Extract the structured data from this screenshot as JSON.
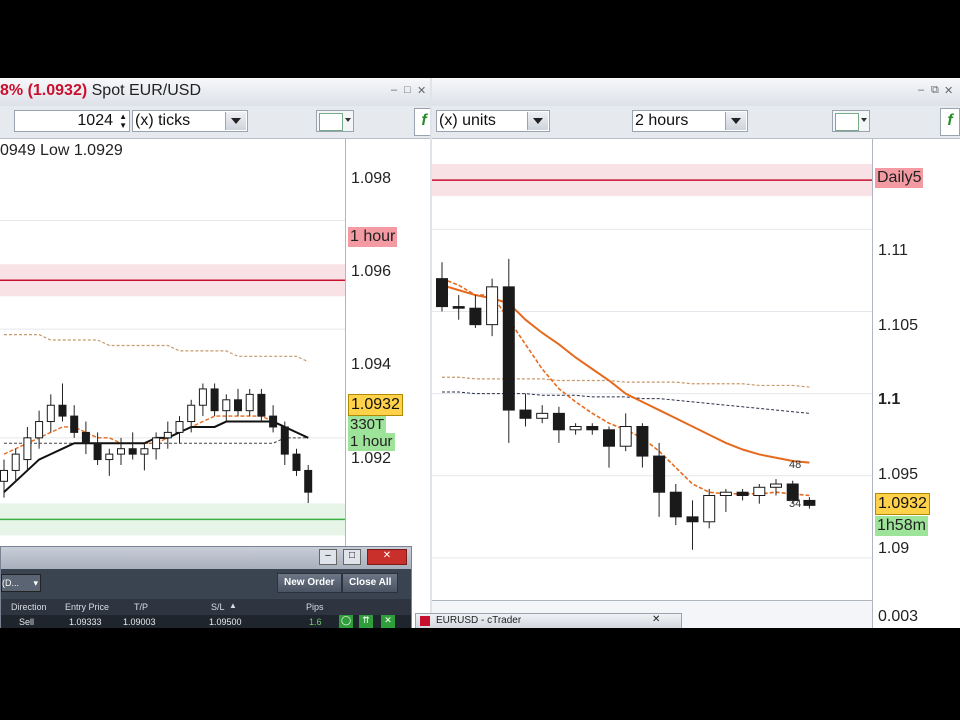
{
  "left": {
    "title_pct": "8% (1.0932)",
    "title_symbol": "Spot EUR/USD",
    "ticks_value": "1024",
    "ticks_unit": "(x) ticks",
    "hilo": "0949 Low 1.0929",
    "y_labels": [
      "1.098",
      "1.096",
      "1.094",
      "1.092"
    ],
    "tag_hour_red": "1 hour",
    "tag_price": "1.0932",
    "tag_ticks": "330T",
    "tag_hour_green": "1 hour"
  },
  "right": {
    "units_label": "(x) units",
    "timeframe": "2 hours",
    "y_labels": [
      "1.11",
      "1.105",
      "1.1",
      "1.095",
      "1.09"
    ],
    "tag_daily": "Daily5",
    "tag_price": "1.0932",
    "tag_time": "1h58m",
    "candle_label_top": "48",
    "candle_label_bot": "34",
    "sub_value": "0.003"
  },
  "panel": {
    "filter": "(D...",
    "new_order": "New Order",
    "close_all": "Close All",
    "columns": [
      "Direction",
      "Entry Price",
      "T/P",
      "S/L",
      "Pips"
    ],
    "row": [
      "Sell",
      "1.09333",
      "1.09003",
      "1.09500",
      "1.6"
    ]
  },
  "taskbar": {
    "label": "EURUSD - cTrader"
  },
  "colors": {
    "red_line": "#c8102e",
    "green_line": "#3cb043",
    "price_tag": "#ffd24a",
    "ma_orange": "#e56a1e"
  },
  "chart_data": [
    {
      "type": "candlestick",
      "title": "Spot EUR/USD",
      "ylim": [
        1.0905,
        1.0995
      ],
      "y_ticks": [
        1.098,
        1.096,
        1.094,
        1.092
      ],
      "levels": [
        1.0969,
        1.0925
      ],
      "candles": [
        [
          1.0932,
          1.0936,
          1.0929,
          1.0934
        ],
        [
          1.0934,
          1.0938,
          1.0932,
          1.0937
        ],
        [
          1.0936,
          1.0942,
          1.0934,
          1.094
        ],
        [
          1.094,
          1.0945,
          1.0938,
          1.0943
        ],
        [
          1.0943,
          1.0948,
          1.0941,
          1.0946
        ],
        [
          1.0946,
          1.095,
          1.0943,
          1.0944
        ],
        [
          1.0944,
          1.0946,
          1.094,
          1.0941
        ],
        [
          1.0941,
          1.0943,
          1.0937,
          1.0939
        ],
        [
          1.0939,
          1.0941,
          1.0935,
          1.0936
        ],
        [
          1.0936,
          1.0938,
          1.0933,
          1.0937
        ],
        [
          1.0937,
          1.094,
          1.0935,
          1.0938
        ],
        [
          1.0938,
          1.0941,
          1.0936,
          1.0937
        ],
        [
          1.0937,
          1.0939,
          1.0934,
          1.0938
        ],
        [
          1.0938,
          1.0941,
          1.0936,
          1.094
        ],
        [
          1.094,
          1.0943,
          1.0938,
          1.0941
        ],
        [
          1.0941,
          1.0944,
          1.0939,
          1.0943
        ],
        [
          1.0943,
          1.0947,
          1.0941,
          1.0946
        ],
        [
          1.0946,
          1.095,
          1.0944,
          1.0949
        ],
        [
          1.0949,
          1.095,
          1.0944,
          1.0945
        ],
        [
          1.0945,
          1.0948,
          1.0943,
          1.0947
        ],
        [
          1.0947,
          1.0949,
          1.0944,
          1.0945
        ],
        [
          1.0945,
          1.0949,
          1.0944,
          1.0948
        ],
        [
          1.0948,
          1.0949,
          1.0943,
          1.0944
        ],
        [
          1.0944,
          1.0946,
          1.0941,
          1.0942
        ],
        [
          1.0942,
          1.0943,
          1.0935,
          1.0937
        ],
        [
          1.0937,
          1.0938,
          1.0933,
          1.0934
        ],
        [
          1.0934,
          1.0935,
          1.0928,
          1.093
        ]
      ],
      "ma_solid": [
        1.093,
        1.0932,
        1.0934,
        1.0936,
        1.0937,
        1.0938,
        1.0939,
        1.0939,
        1.0939,
        1.0939,
        1.0939,
        1.0939,
        1.0939,
        1.094,
        1.094,
        1.0941,
        1.0942,
        1.0942,
        1.0942,
        1.0943,
        1.0943,
        1.0943,
        1.0943,
        1.0943,
        1.0942,
        1.0941,
        1.094
      ],
      "ma_dashed": [
        1.0937,
        1.0938,
        1.0939,
        1.094,
        1.0941,
        1.0942,
        1.0942,
        1.0941,
        1.094,
        1.094,
        1.0939,
        1.0939,
        1.0939,
        1.0939,
        1.094,
        1.0941,
        1.0942,
        1.0943,
        1.0944,
        1.0944,
        1.0944,
        1.0944,
        1.0944,
        1.0943,
        1.0942,
        1.0941,
        1.094
      ],
      "ma_slow": [
        1.0939,
        1.0939,
        1.0939,
        1.0939,
        1.0939,
        1.0939,
        1.0939,
        1.0939,
        1.0939,
        1.0939,
        1.0939,
        1.0939,
        1.0939,
        1.0939,
        1.0939,
        1.0939,
        1.0939,
        1.0939,
        1.0939,
        1.0939,
        1.0939,
        1.0939,
        1.0939,
        1.0939,
        1.094,
        1.094,
        1.094
      ],
      "ma_brown": [
        1.0959,
        1.0959,
        1.0959,
        1.0959,
        1.0958,
        1.0958,
        1.0958,
        1.0958,
        1.0958,
        1.0957,
        1.0957,
        1.0957,
        1.0957,
        1.0957,
        1.0957,
        1.0956,
        1.0956,
        1.0956,
        1.0956,
        1.0956,
        1.0955,
        1.0955,
        1.0955,
        1.0955,
        1.0955,
        1.0955,
        1.0954
      ]
    },
    {
      "type": "candlestick",
      "title": "2 hours",
      "ylim": [
        1.0875,
        1.1155
      ],
      "y_ticks": [
        1.11,
        1.105,
        1.1,
        1.095,
        1.09
      ],
      "levels": [
        1.113
      ],
      "candles": [
        [
          1.107,
          1.108,
          1.105,
          1.1053
        ],
        [
          1.1053,
          1.106,
          1.1045,
          1.1052
        ],
        [
          1.1052,
          1.106,
          1.104,
          1.1042
        ],
        [
          1.1042,
          1.107,
          1.1035,
          1.1065
        ],
        [
          1.1065,
          1.1082,
          1.097,
          1.099
        ],
        [
          1.099,
          1.1,
          1.098,
          1.0985
        ],
        [
          1.0985,
          1.0993,
          1.0982,
          1.0988
        ],
        [
          1.0988,
          1.0992,
          1.097,
          1.0978
        ],
        [
          1.0978,
          1.0982,
          1.0975,
          1.098
        ],
        [
          1.098,
          1.0982,
          1.0975,
          1.0978
        ],
        [
          1.0978,
          1.098,
          1.0955,
          1.0968
        ],
        [
          1.0968,
          1.0988,
          1.0965,
          1.098
        ],
        [
          1.098,
          1.0982,
          1.0955,
          1.0962
        ],
        [
          1.0962,
          1.097,
          1.0925,
          1.094
        ],
        [
          1.094,
          1.0945,
          1.092,
          1.0925
        ],
        [
          1.0925,
          1.0935,
          1.0905,
          1.0922
        ],
        [
          1.0922,
          1.0942,
          1.0918,
          1.0938
        ],
        [
          1.0938,
          1.0942,
          1.0928,
          1.094
        ],
        [
          1.094,
          1.0942,
          1.0935,
          1.0938
        ],
        [
          1.0938,
          1.0945,
          1.0933,
          1.0943
        ],
        [
          1.0943,
          1.0948,
          1.0938,
          1.0945
        ],
        [
          1.0945,
          1.0947,
          1.0933,
          1.0935
        ],
        [
          1.0935,
          1.0937,
          1.093,
          1.0932
        ]
      ],
      "ma_orange": [
        1.1066,
        1.1063,
        1.106,
        1.1058,
        1.1055,
        1.1045,
        1.1037,
        1.103,
        1.1022,
        1.1015,
        1.1008,
        1.1,
        1.0995,
        1.099,
        1.0985,
        1.098,
        1.0975,
        1.097,
        1.0966,
        1.0963,
        1.0961,
        1.0959,
        1.0958
      ],
      "ma_orange_dashed": [
        1.107,
        1.1066,
        1.106,
        1.106,
        1.1045,
        1.103,
        1.1015,
        1.1003,
        1.0995,
        1.0988,
        1.0982,
        1.0978,
        1.0973,
        1.0965,
        1.0955,
        1.0945,
        1.094,
        1.0939,
        1.0939,
        1.0939,
        1.094,
        1.0939,
        1.0938
      ],
      "ma_brown": [
        1.101,
        1.101,
        1.1009,
        1.1009,
        1.1009,
        1.1009,
        1.1009,
        1.1008,
        1.1008,
        1.1008,
        1.1008,
        1.1007,
        1.1007,
        1.1007,
        1.1007,
        1.1006,
        1.1006,
        1.1006,
        1.1006,
        1.1005,
        1.1005,
        1.1005,
        1.1004
      ],
      "ma_navy": [
        1.1001,
        1.1001,
        1.1,
        1.1,
        1.1,
        1.1,
        1.0999,
        1.0999,
        1.0999,
        1.0998,
        1.0998,
        1.0998,
        1.0997,
        1.0997,
        1.0996,
        1.0995,
        1.0994,
        1.0993,
        1.0992,
        1.0991,
        1.099,
        1.0989,
        1.0988
      ]
    }
  ]
}
